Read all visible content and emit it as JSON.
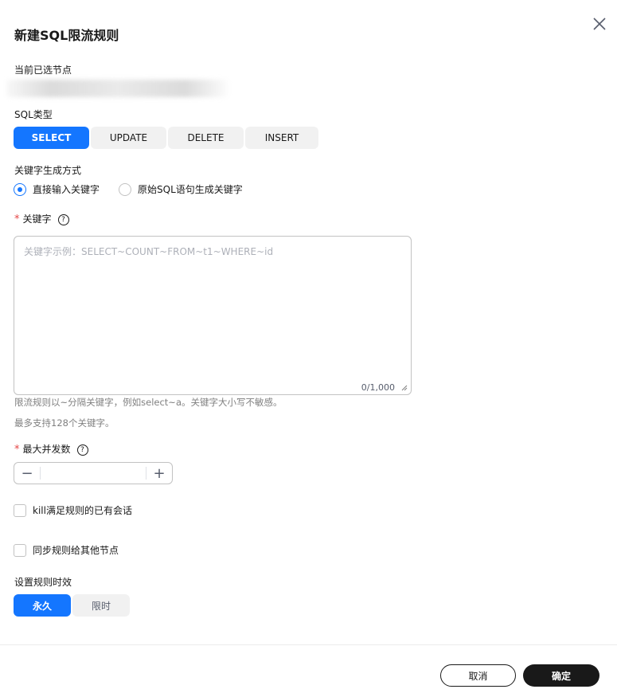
{
  "dialog": {
    "title": "新建SQL限流规则"
  },
  "node": {
    "label": "当前已选节点"
  },
  "sql_type": {
    "label": "SQL类型",
    "options": [
      "SELECT",
      "UPDATE",
      "DELETE",
      "INSERT"
    ],
    "selected": "SELECT"
  },
  "keyword_mode": {
    "label": "关键字生成方式",
    "options": [
      "直接输入关键字",
      "原始SQL语句生成关键字"
    ],
    "selected": "直接输入关键字"
  },
  "keyword": {
    "label": "关键字",
    "required_mark": "*",
    "help": "?",
    "placeholder": "关键字示例：SELECT~COUNT~FROM~t1~WHERE~id",
    "count": "0/1,000",
    "hint1": "限流规则以~分隔关键字，例如select~a。关键字大小写不敏感。",
    "hint2": "最多支持128个关键字。"
  },
  "max_concurrency": {
    "label": "最大并发数",
    "required_mark": "*",
    "help": "?",
    "minus": "−",
    "plus": "+"
  },
  "checkboxes": {
    "kill_sessions": "kill满足规则的已有会话",
    "sync_nodes": "同步规则给其他节点"
  },
  "validity": {
    "label": "设置规则时效",
    "options": [
      "永久",
      "限时"
    ],
    "selected": "永久"
  },
  "footer": {
    "cancel": "取消",
    "confirm": "确定"
  },
  "colors": {
    "primary": "#1476ff",
    "required": "#e54545",
    "confirm_bg": "#191919"
  }
}
